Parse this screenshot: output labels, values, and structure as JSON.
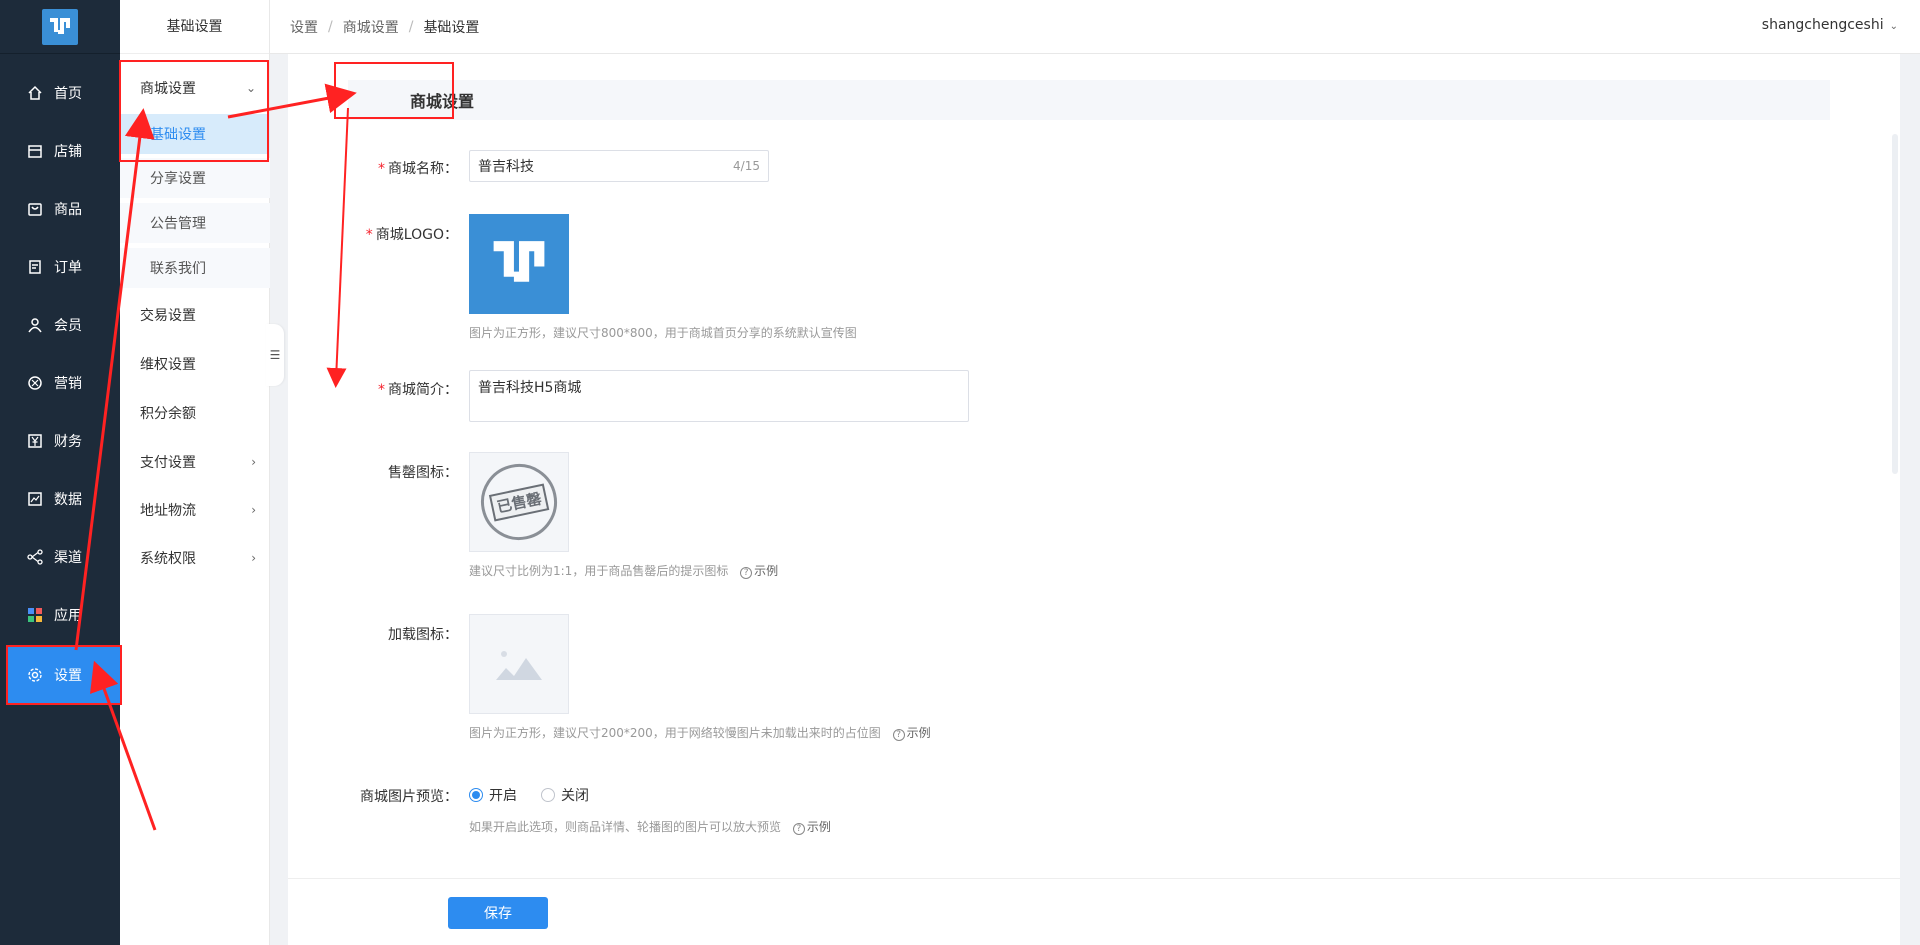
{
  "nav": {
    "items": [
      {
        "label": "首页",
        "icon": "home-icon"
      },
      {
        "label": "店铺",
        "icon": "store-icon"
      },
      {
        "label": "商品",
        "icon": "bag-icon"
      },
      {
        "label": "订单",
        "icon": "order-icon"
      },
      {
        "label": "会员",
        "icon": "user-icon"
      },
      {
        "label": "营销",
        "icon": "marketing-icon"
      },
      {
        "label": "财务",
        "icon": "yuan-icon"
      },
      {
        "label": "数据",
        "icon": "chart-icon"
      },
      {
        "label": "渠道",
        "icon": "share-icon"
      },
      {
        "label": "应用",
        "icon": "apps-icon"
      },
      {
        "label": "设置",
        "icon": "gear-icon"
      }
    ],
    "active": "设置"
  },
  "subnav": {
    "title": "基础设置",
    "group_mall": "商城设置",
    "children": [
      "基础设置",
      "分享设置",
      "公告管理",
      "联系我们"
    ],
    "items": [
      "交易设置",
      "维权设置",
      "积分余额",
      "支付设置",
      "地址物流",
      "系统权限"
    ]
  },
  "breadcrumb": [
    "设置",
    "商城设置",
    "基础设置"
  ],
  "user": {
    "name": "shangchengceshi"
  },
  "section": {
    "title": "商城设置"
  },
  "form": {
    "name_label": "商城名称：",
    "name_value": "普吉科技",
    "name_counter": "4/15",
    "logo_label": "商城LOGO：",
    "logo_hint": "图片为正方形，建议尺寸800*800，用于商城首页分享的系统默认宣传图",
    "intro_label": "商城简介：",
    "intro_value": "普吉科技H5商城",
    "soldout_label": "售罄图标：",
    "soldout_stamp": "已售罄",
    "soldout_hint": "建议尺寸比例为1:1，用于商品售罄后的提示图标",
    "example": "示例",
    "loading_label": "加载图标：",
    "loading_hint": "图片为正方形，建议尺寸200*200，用于网络较慢图片未加载出来时的占位图",
    "preview_label": "商城图片预览：",
    "preview_on": "开启",
    "preview_off": "关闭",
    "preview_hint": "如果开启此选项，则商品详情、轮播图的图片可以放大预览"
  },
  "save_label": "保存",
  "colors": {
    "nav_bg": "#1d2b3a",
    "accent": "#2d8cf0",
    "logo_bg": "#3a8fd6",
    "annotation": "#ff2222"
  }
}
